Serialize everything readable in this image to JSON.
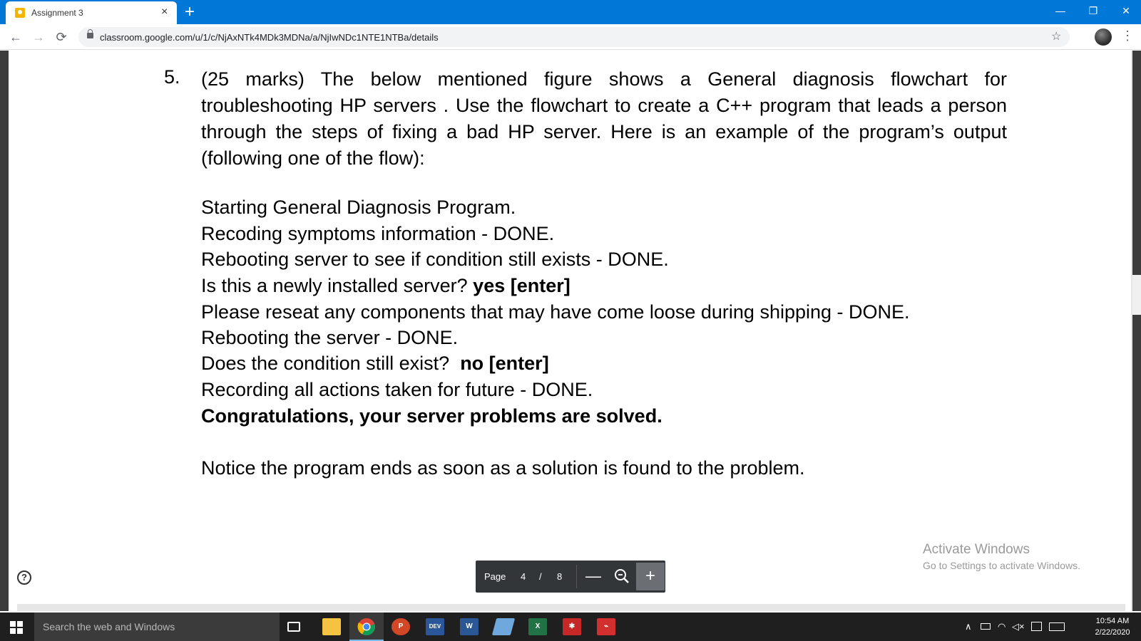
{
  "browser": {
    "tab_title": "Assignment 3",
    "url": "classroom.google.com/u/1/c/NjAxNTk4MDk3MDNa/a/NjIwNDc1NTE1NTBa/details",
    "window_controls": {
      "minimize": "—",
      "restore": "❐",
      "close": "✕"
    },
    "nav": {
      "back": "←",
      "forward": "→",
      "reload": "⟳"
    },
    "star": "☆",
    "menu": "⋮"
  },
  "document": {
    "question_number": "5.",
    "question_text": "(25 marks) The below mentioned figure shows a General diagnosis flowchart for troubleshooting HP servers . Use the flowchart to create a C++ program that leads a person through the steps of fixing a bad HP server. Here is an example of the program’s output (following one of the flow):",
    "output_lines": [
      {
        "text": "Starting General Diagnosis Program.",
        "input": ""
      },
      {
        "text": "Recoding symptoms information - DONE.",
        "input": ""
      },
      {
        "text": "Rebooting server to see if condition still exists - DONE.",
        "input": ""
      },
      {
        "text": "Is this a newly installed server? ",
        "input": "yes [enter]"
      },
      {
        "text": "Please reseat any components that may have come loose during shipping - DONE.",
        "input": ""
      },
      {
        "text": "Rebooting the server - DONE.",
        "input": ""
      },
      {
        "text": "Does the condition still exist?  ",
        "input": "no [enter]"
      },
      {
        "text": "Recording all actions taken for future - DONE.",
        "input": ""
      }
    ],
    "congrats": "Congratulations, your server problems are solved.",
    "notice": "Notice the program ends as soon as a solution is found to the problem."
  },
  "viewer": {
    "help": "?",
    "page_label": "Page",
    "current_page": "4",
    "separator": "/",
    "total_pages": "8",
    "zoom_out": "—",
    "zoom_in": "+"
  },
  "watermark": {
    "line1": "Activate Windows",
    "line2": "Go to Settings to activate Windows."
  },
  "taskbar": {
    "search_placeholder": "Search the web and Windows",
    "apps": [
      {
        "name": "task-view",
        "label": ""
      },
      {
        "name": "file-explorer",
        "label": ""
      },
      {
        "name": "chrome",
        "label": ""
      },
      {
        "name": "powerpoint",
        "label": "P"
      },
      {
        "name": "devc",
        "label": "DEV"
      },
      {
        "name": "word",
        "label": "W"
      },
      {
        "name": "notepad",
        "label": ""
      },
      {
        "name": "excel",
        "label": "X"
      },
      {
        "name": "gear-app",
        "label": ""
      },
      {
        "name": "acrobat",
        "label": ""
      }
    ],
    "time": "10:54 AM",
    "date": "2/22/2020"
  }
}
